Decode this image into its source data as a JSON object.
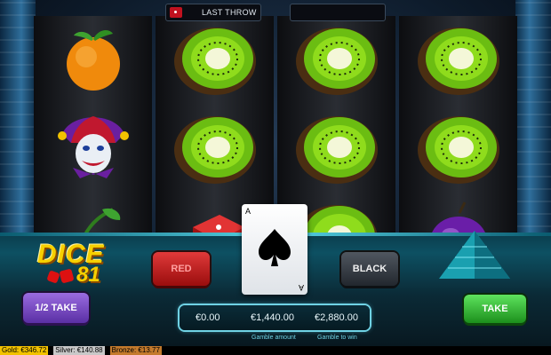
{
  "top_bar": {
    "label": "LAST THROW"
  },
  "logo": {
    "word": "DICE",
    "number": "81"
  },
  "reels": [
    [
      "orange",
      "jester",
      "cherry"
    ],
    [
      "kiwi",
      "kiwi",
      "dice"
    ],
    [
      "kiwi",
      "kiwi",
      "kiwi"
    ],
    [
      "kiwi",
      "kiwi",
      "plum"
    ]
  ],
  "buttons": {
    "red": "RED",
    "black": "BLACK",
    "half_take": "1/2 TAKE",
    "take": "TAKE"
  },
  "card": {
    "rank": "A",
    "suit": "spade-icon"
  },
  "amounts": {
    "current": "€0.00",
    "gamble_amount": "€1,440.00",
    "gamble_to_win": "€2,880.00",
    "gamble_amount_label": "Gamble amount",
    "gamble_to_win_label": "Gamble to win"
  },
  "status": {
    "gold": "Gold: €346.72",
    "silver": "Silver: €140.88",
    "bronze": "Bronze: €13.77"
  },
  "colors": {
    "gold": "#f2c200",
    "silver": "#c8c8c8",
    "bronze": "#c47a2c",
    "red_button": "#b01818",
    "take_button": "#2aa52a",
    "half_take_button": "#7040c0"
  }
}
